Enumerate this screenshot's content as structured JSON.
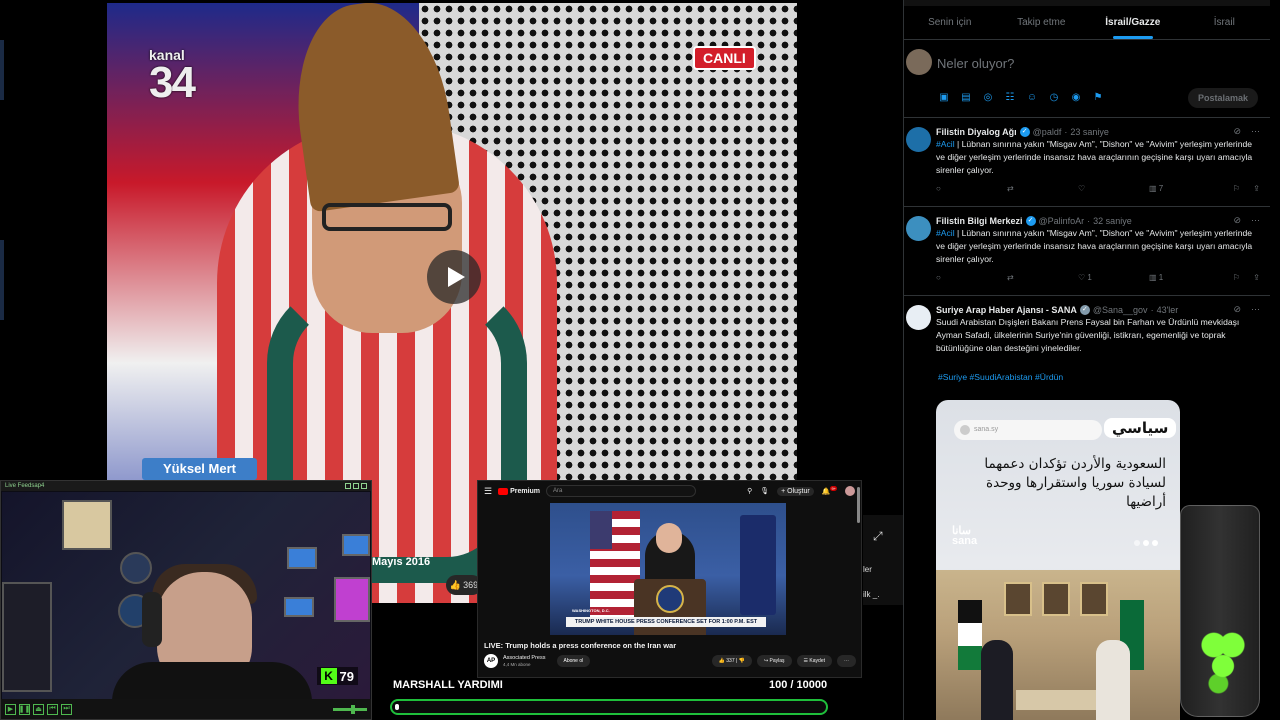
{
  "main_video": {
    "channel_logo_word": "kanal",
    "channel_logo_number": "34",
    "live_badge": "CANLI",
    "name_strip": "Yüksel Mert",
    "caption": "Mayıs 2016",
    "likes": "369"
  },
  "side_strip": {
    "line1": "ler",
    "line2": "ilk _."
  },
  "feed_window": {
    "title": "Live Feedsap4",
    "kick_viewers": "79"
  },
  "youtube": {
    "brand": "Premium",
    "search_placeholder": "Ara",
    "create_label": "Oluştur",
    "notification_count": "9+",
    "lower_third": "TRUMP WHITE HOUSE PRESS CONFERENCE SET FOR 1:00 P.M. EST",
    "location": "WASHINGTON, D.C.",
    "video_title": "LIVE: Trump holds a press conference on the Iran war",
    "channel_initials": "AP",
    "channel_name": "Associated Press",
    "channel_subs": "4,4 Mn abone",
    "subscribe_label": "Abone ol",
    "like_count": "337",
    "share_label": "Paylaş",
    "save_label": "Kaydet"
  },
  "goal": {
    "label": "MARSHALL YARDIMI",
    "count": "100 / 10000",
    "progress_fraction": 0.01
  },
  "x_panel": {
    "tabs": [
      {
        "label": "Senin için",
        "active": false
      },
      {
        "label": "Takip etme",
        "active": false
      },
      {
        "label": "İsrail/Gazze",
        "active": true
      },
      {
        "label": "İsrail",
        "active": false
      }
    ],
    "compose_placeholder": "Neler oluyor?",
    "post_button": "Postalamak",
    "tweets": [
      {
        "name": "Filistin Diyalog Ağı",
        "handle": "@paldf",
        "time": "23 saniye",
        "tag": "#Acil",
        "text": " | Lübnan sınırına yakın \"Misgav Am\", \"Dishon\" ve \"Avivim\" yerleşim yerlerinde ve diğer yerleşim yerlerinde insansız hava araçlarının geçişine karşı uyarı amacıyla sirenler çalıyor.",
        "replies": "",
        "retweets": "",
        "likes": "",
        "views": "7",
        "avatar_color": "#1d6fa8"
      },
      {
        "name": "Filistin Bilgi Merkezi",
        "handle": "@PalinfoAr",
        "time": "32 saniye",
        "tag": "#Acil",
        "text": " | Lübnan sınırına yakın \"Misgav Am\", \"Dishon\" ve \"Avivim\" yerleşim yerlerinde ve diğer yerleşim yerlerinde insansız hava araçlarının geçişine karşı uyarı amacıyla sirenler çalıyor.",
        "replies": "",
        "retweets": "",
        "likes": "1",
        "views": "1",
        "avatar_color": "#3c8fbf"
      },
      {
        "name": "Suriye Arap Haber Ajansı - SANA",
        "handle": "@Sana__gov",
        "time": "43'ler",
        "tag": "",
        "text": "Suudi Arabistan Dışişleri Bakanı Prens Faysal bin Farhan ve Ürdünlü mevkidaşı Ayman Safadi, ülkelerinin Suriye'nin güvenliği, istikrarı, egemenliği ve toprak bütünlüğüne olan desteğini yinelediler.",
        "hashtags": "#Suriye #SuudiArabistan #Ürdün",
        "avatar_color": "#e8eef4"
      }
    ],
    "sana_card": {
      "url": "sana.sy",
      "section_tag": "سياسي",
      "headline": "السعودية والأردن تؤكدان دعمهما لسيادة سوريا واستقرارها ووحدة أراضيها",
      "logo_ar": "سانا",
      "logo_en": "sana"
    }
  },
  "colors": {
    "x_accent": "#1d9bf0",
    "goal_border": "#1fbf3b",
    "kick_green": "#53fc18",
    "live_red": "#d31e2a"
  }
}
